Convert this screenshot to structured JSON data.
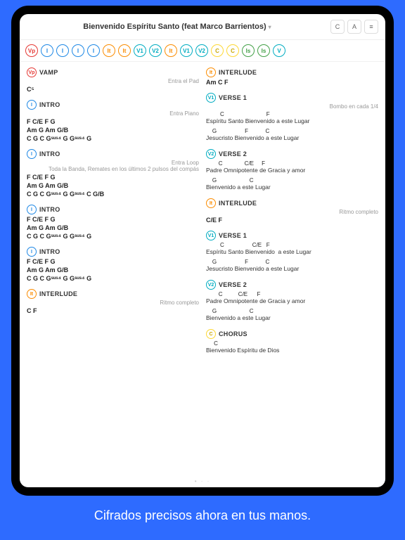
{
  "title": "Bienvenido Espíritu Santo (feat Marco Barrientos)",
  "hbtn": {
    "c": "C",
    "a": "A",
    "s": "≡"
  },
  "pills": [
    {
      "t": "Vp",
      "c": "red"
    },
    {
      "t": "I",
      "c": "blue"
    },
    {
      "t": "I",
      "c": "blue"
    },
    {
      "t": "I",
      "c": "blue"
    },
    {
      "t": "I",
      "c": "blue"
    },
    {
      "t": "It",
      "c": "orange"
    },
    {
      "t": "It",
      "c": "orange"
    },
    {
      "t": "V1",
      "c": "teal"
    },
    {
      "t": "V2",
      "c": "teal"
    },
    {
      "t": "It",
      "c": "orange"
    },
    {
      "t": "V1",
      "c": "teal"
    },
    {
      "t": "V2",
      "c": "teal"
    },
    {
      "t": "C",
      "c": "yellow"
    },
    {
      "t": "C",
      "c": "yellow"
    },
    {
      "t": "Is",
      "c": "green"
    },
    {
      "t": "Is",
      "c": "green"
    },
    {
      "t": "V",
      "c": "teal"
    }
  ],
  "left": [
    {
      "pill": {
        "t": "Vp",
        "c": "red"
      },
      "name": "VAMP",
      "note": "Entra el Pad",
      "lines": [
        "C⁵"
      ]
    },
    {
      "pill": {
        "t": "I",
        "c": "blue"
      },
      "name": "INTRO",
      "note": "Entra Piano",
      "lines": [
        "F C/E F G",
        "Am G Am G/B",
        "C G C Gˢᵘˢ⁴ G Gˢᵘˢ⁴ G"
      ]
    },
    {
      "pill": {
        "t": "I",
        "c": "blue"
      },
      "name": "INTRO",
      "note": "Entra Loop\nToda la Banda, Remates en los últimos 2 pulsos del compás",
      "lines": [
        "F C/E F G",
        "Am G Am G/B",
        "C G C Gˢᵘˢ⁴ G Gˢᵘˢ⁴ C G/B"
      ]
    },
    {
      "pill": {
        "t": "I",
        "c": "blue"
      },
      "name": "INTRO",
      "note": "",
      "lines": [
        "F C/E F G",
        "Am G Am G/B",
        "C G C Gˢᵘˢ⁴ G Gˢᵘˢ⁴ G"
      ]
    },
    {
      "pill": {
        "t": "I",
        "c": "blue"
      },
      "name": "INTRO",
      "note": "",
      "lines": [
        "F C/E F G",
        "Am G Am G/B",
        "C G C Gˢᵘˢ⁴ G Gˢᵘˢ⁴ G"
      ]
    },
    {
      "pill": {
        "t": "It",
        "c": "orange"
      },
      "name": "INTERLUDE",
      "note": "Ritmo completo",
      "lines": [
        "C F"
      ]
    }
  ],
  "right": [
    {
      "pill": {
        "t": "It",
        "c": "orange"
      },
      "name": "INTERLUDE",
      "note": "",
      "lines": [
        "Am C F"
      ]
    },
    {
      "pill": {
        "t": "V1",
        "c": "teal"
      },
      "name": "VERSE 1",
      "note": "Bombo en cada 1/4",
      "lyrics": [
        {
          "c": "         C                           F",
          "l": "Espíritu Santo Bienvenido a este Lugar"
        },
        {
          "c": "    G                  F           C",
          "l": "Jesucristo Bienvenido a este Lugar"
        }
      ]
    },
    {
      "pill": {
        "t": "V2",
        "c": "teal"
      },
      "name": "VERSE 2",
      "note": "",
      "lyrics": [
        {
          "c": "        C              C/E     F",
          "l": "Padre Omnipotente de Gracia y amor"
        },
        {
          "c": "    G                     C",
          "l": "Bienvenido a este Lugar"
        }
      ]
    },
    {
      "pill": {
        "t": "It",
        "c": "orange"
      },
      "name": "INTERLUDE",
      "note": "Ritmo completo",
      "lines": [
        "C/E F"
      ]
    },
    {
      "pill": {
        "t": "V1",
        "c": "teal"
      },
      "name": "VERSE 1",
      "note": "",
      "lyrics": [
        {
          "c": "         C                  C/E   F",
          "l": "Espíritu Santo Bienvenido  a este Lugar"
        },
        {
          "c": "    G                  F           C",
          "l": "Jesucristo Bienvenido a este Lugar"
        }
      ]
    },
    {
      "pill": {
        "t": "V2",
        "c": "teal"
      },
      "name": "VERSE 2",
      "note": "",
      "lyrics": [
        {
          "c": "        C          C/E      F",
          "l": "Padre Omnipotente de Gracia y amor"
        },
        {
          "c": "    G                     C",
          "l": "Bienvenido a este Lugar"
        }
      ]
    },
    {
      "pill": {
        "t": "C",
        "c": "yellow"
      },
      "name": "CHORUS",
      "note": "",
      "lyrics": [
        {
          "c": "     C",
          "l": "Bienvenido Espíritu de Dios"
        }
      ]
    }
  ],
  "tagline": "Cifrados precisos ahora en tus manos."
}
